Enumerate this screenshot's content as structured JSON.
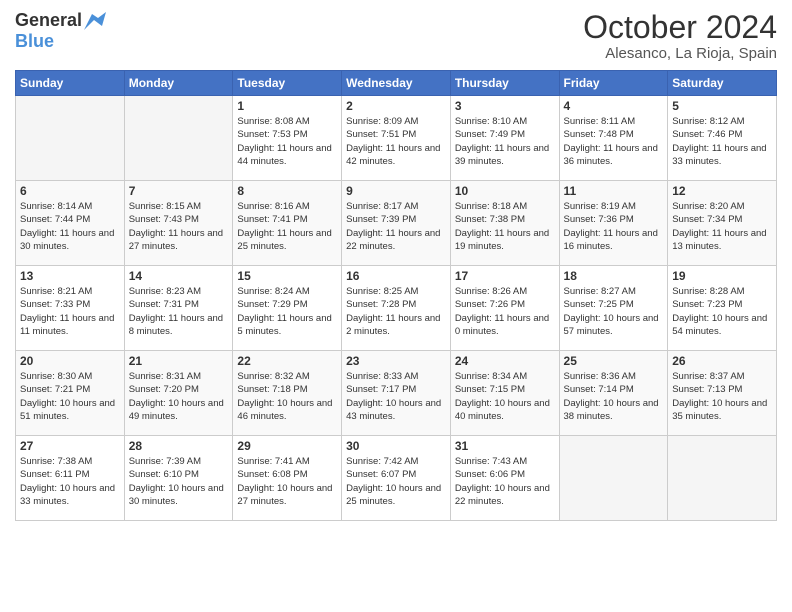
{
  "logo": {
    "general": "General",
    "blue": "Blue"
  },
  "title": {
    "month": "October 2024",
    "location": "Alesanco, La Rioja, Spain"
  },
  "days_of_week": [
    "Sunday",
    "Monday",
    "Tuesday",
    "Wednesday",
    "Thursday",
    "Friday",
    "Saturday"
  ],
  "weeks": [
    [
      {
        "day": "",
        "info": ""
      },
      {
        "day": "",
        "info": ""
      },
      {
        "day": "1",
        "info": "Sunrise: 8:08 AM\nSunset: 7:53 PM\nDaylight: 11 hours and 44 minutes."
      },
      {
        "day": "2",
        "info": "Sunrise: 8:09 AM\nSunset: 7:51 PM\nDaylight: 11 hours and 42 minutes."
      },
      {
        "day": "3",
        "info": "Sunrise: 8:10 AM\nSunset: 7:49 PM\nDaylight: 11 hours and 39 minutes."
      },
      {
        "day": "4",
        "info": "Sunrise: 8:11 AM\nSunset: 7:48 PM\nDaylight: 11 hours and 36 minutes."
      },
      {
        "day": "5",
        "info": "Sunrise: 8:12 AM\nSunset: 7:46 PM\nDaylight: 11 hours and 33 minutes."
      }
    ],
    [
      {
        "day": "6",
        "info": "Sunrise: 8:14 AM\nSunset: 7:44 PM\nDaylight: 11 hours and 30 minutes."
      },
      {
        "day": "7",
        "info": "Sunrise: 8:15 AM\nSunset: 7:43 PM\nDaylight: 11 hours and 27 minutes."
      },
      {
        "day": "8",
        "info": "Sunrise: 8:16 AM\nSunset: 7:41 PM\nDaylight: 11 hours and 25 minutes."
      },
      {
        "day": "9",
        "info": "Sunrise: 8:17 AM\nSunset: 7:39 PM\nDaylight: 11 hours and 22 minutes."
      },
      {
        "day": "10",
        "info": "Sunrise: 8:18 AM\nSunset: 7:38 PM\nDaylight: 11 hours and 19 minutes."
      },
      {
        "day": "11",
        "info": "Sunrise: 8:19 AM\nSunset: 7:36 PM\nDaylight: 11 hours and 16 minutes."
      },
      {
        "day": "12",
        "info": "Sunrise: 8:20 AM\nSunset: 7:34 PM\nDaylight: 11 hours and 13 minutes."
      }
    ],
    [
      {
        "day": "13",
        "info": "Sunrise: 8:21 AM\nSunset: 7:33 PM\nDaylight: 11 hours and 11 minutes."
      },
      {
        "day": "14",
        "info": "Sunrise: 8:23 AM\nSunset: 7:31 PM\nDaylight: 11 hours and 8 minutes."
      },
      {
        "day": "15",
        "info": "Sunrise: 8:24 AM\nSunset: 7:29 PM\nDaylight: 11 hours and 5 minutes."
      },
      {
        "day": "16",
        "info": "Sunrise: 8:25 AM\nSunset: 7:28 PM\nDaylight: 11 hours and 2 minutes."
      },
      {
        "day": "17",
        "info": "Sunrise: 8:26 AM\nSunset: 7:26 PM\nDaylight: 11 hours and 0 minutes."
      },
      {
        "day": "18",
        "info": "Sunrise: 8:27 AM\nSunset: 7:25 PM\nDaylight: 10 hours and 57 minutes."
      },
      {
        "day": "19",
        "info": "Sunrise: 8:28 AM\nSunset: 7:23 PM\nDaylight: 10 hours and 54 minutes."
      }
    ],
    [
      {
        "day": "20",
        "info": "Sunrise: 8:30 AM\nSunset: 7:21 PM\nDaylight: 10 hours and 51 minutes."
      },
      {
        "day": "21",
        "info": "Sunrise: 8:31 AM\nSunset: 7:20 PM\nDaylight: 10 hours and 49 minutes."
      },
      {
        "day": "22",
        "info": "Sunrise: 8:32 AM\nSunset: 7:18 PM\nDaylight: 10 hours and 46 minutes."
      },
      {
        "day": "23",
        "info": "Sunrise: 8:33 AM\nSunset: 7:17 PM\nDaylight: 10 hours and 43 minutes."
      },
      {
        "day": "24",
        "info": "Sunrise: 8:34 AM\nSunset: 7:15 PM\nDaylight: 10 hours and 40 minutes."
      },
      {
        "day": "25",
        "info": "Sunrise: 8:36 AM\nSunset: 7:14 PM\nDaylight: 10 hours and 38 minutes."
      },
      {
        "day": "26",
        "info": "Sunrise: 8:37 AM\nSunset: 7:13 PM\nDaylight: 10 hours and 35 minutes."
      }
    ],
    [
      {
        "day": "27",
        "info": "Sunrise: 7:38 AM\nSunset: 6:11 PM\nDaylight: 10 hours and 33 minutes."
      },
      {
        "day": "28",
        "info": "Sunrise: 7:39 AM\nSunset: 6:10 PM\nDaylight: 10 hours and 30 minutes."
      },
      {
        "day": "29",
        "info": "Sunrise: 7:41 AM\nSunset: 6:08 PM\nDaylight: 10 hours and 27 minutes."
      },
      {
        "day": "30",
        "info": "Sunrise: 7:42 AM\nSunset: 6:07 PM\nDaylight: 10 hours and 25 minutes."
      },
      {
        "day": "31",
        "info": "Sunrise: 7:43 AM\nSunset: 6:06 PM\nDaylight: 10 hours and 22 minutes."
      },
      {
        "day": "",
        "info": ""
      },
      {
        "day": "",
        "info": ""
      }
    ]
  ]
}
